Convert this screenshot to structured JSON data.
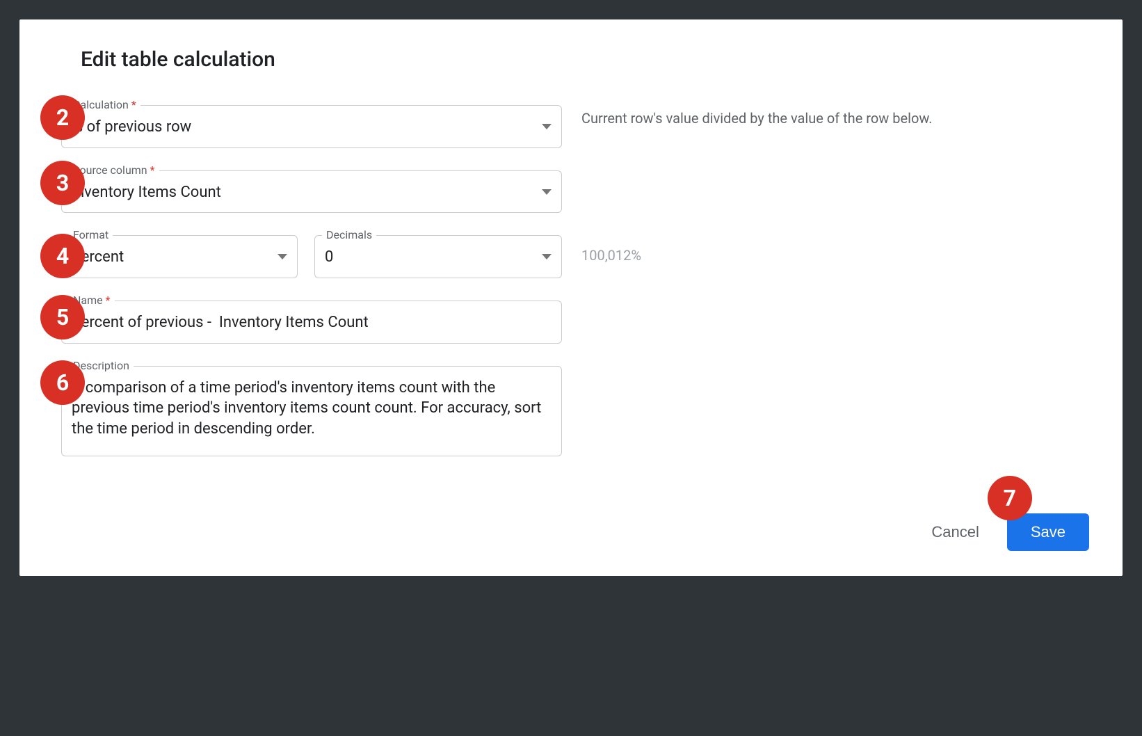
{
  "dialog": {
    "title": "Edit table calculation"
  },
  "annotations": {
    "n2": "2",
    "n3": "3",
    "n4": "4",
    "n5": "5",
    "n6": "6",
    "n7": "7"
  },
  "fields": {
    "calculation": {
      "label": "Calculation",
      "required": true,
      "value": "% of previous row",
      "helper": "Current row's value divided by the value of the row below."
    },
    "source_column": {
      "label": "Source column",
      "required": true,
      "value": "Inventory Items Count"
    },
    "format": {
      "label": "Format",
      "value": "Percent"
    },
    "decimals": {
      "label": "Decimals",
      "value": "0"
    },
    "format_preview": "100,012%",
    "name": {
      "label": "Name",
      "required": true,
      "value": "Percent of previous -  Inventory Items Count"
    },
    "description": {
      "label": "Description",
      "value": "A comparison of a time period's inventory items count with the previous time period's inventory items count count. For accuracy, sort the time period in descending order."
    }
  },
  "actions": {
    "cancel": "Cancel",
    "save": "Save"
  },
  "required_marker": "*"
}
